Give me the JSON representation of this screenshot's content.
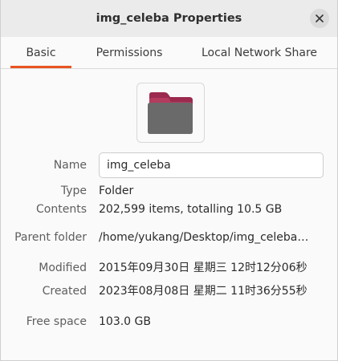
{
  "window": {
    "title": "img_celeba Properties"
  },
  "tabs": [
    {
      "label": "Basic",
      "active": true
    },
    {
      "label": "Permissions",
      "active": false
    },
    {
      "label": "Local Network Share",
      "active": false
    }
  ],
  "icons": {
    "close": "close-icon",
    "folder": "folder-icon"
  },
  "colors": {
    "accent": "#e95420",
    "folder_body": "#6a6a6a",
    "folder_tab": "#9b2a4e"
  },
  "properties": {
    "name_label": "Name",
    "name_value": "img_celeba",
    "type_label": "Type",
    "type_value": "Folder",
    "contents_label": "Contents",
    "contents_value": "202,599 items, totalling 10.5 GB",
    "parent_label": "Parent folder",
    "parent_value": "/home/yukang/Desktop/img_celeba—…",
    "modified_label": "Modified",
    "modified_value": "2015年09月30日 星期三 12时12分06秒",
    "created_label": "Created",
    "created_value": "2023年08月08日 星期二 11时36分55秒",
    "free_label": "Free space",
    "free_value": "103.0 GB"
  }
}
